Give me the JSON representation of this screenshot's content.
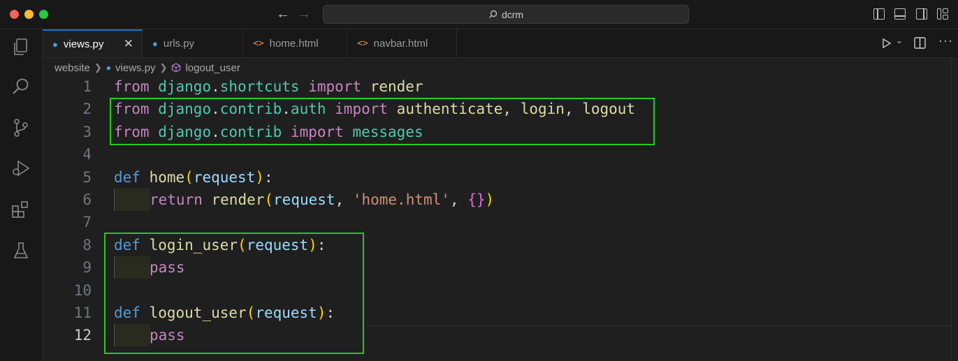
{
  "window": {
    "command_center": "dcrm"
  },
  "tabs": [
    {
      "label": "views.py",
      "type": "python",
      "active": true
    },
    {
      "label": "urls.py",
      "type": "python",
      "active": false
    },
    {
      "label": "home.html",
      "type": "html",
      "active": false
    },
    {
      "label": "navbar.html",
      "type": "html",
      "active": false
    }
  ],
  "breadcrumb": {
    "folder": "website",
    "file": "views.py",
    "symbol": "logout_user"
  },
  "editor": {
    "language": "python",
    "current_line": 12,
    "lines": [
      {
        "n": "1",
        "tokens": [
          [
            "kw-import",
            "from"
          ],
          [
            "plain",
            " "
          ],
          [
            "mod",
            "django"
          ],
          [
            "plain",
            "."
          ],
          [
            "mod",
            "shortcuts"
          ],
          [
            "plain",
            " "
          ],
          [
            "kw-import",
            "import"
          ],
          [
            "plain",
            " "
          ],
          [
            "fn",
            "render"
          ]
        ]
      },
      {
        "n": "2",
        "tokens": [
          [
            "kw-import",
            "from"
          ],
          [
            "plain",
            " "
          ],
          [
            "mod",
            "django"
          ],
          [
            "plain",
            "."
          ],
          [
            "mod",
            "contrib"
          ],
          [
            "plain",
            "."
          ],
          [
            "mod",
            "auth"
          ],
          [
            "plain",
            " "
          ],
          [
            "kw-import",
            "import"
          ],
          [
            "plain",
            " "
          ],
          [
            "fn",
            "authenticate"
          ],
          [
            "plain",
            ", "
          ],
          [
            "fn",
            "login"
          ],
          [
            "plain",
            ", "
          ],
          [
            "fn",
            "logout"
          ]
        ]
      },
      {
        "n": "3",
        "tokens": [
          [
            "kw-import",
            "from"
          ],
          [
            "plain",
            " "
          ],
          [
            "mod",
            "django"
          ],
          [
            "plain",
            "."
          ],
          [
            "mod",
            "contrib"
          ],
          [
            "plain",
            " "
          ],
          [
            "kw-import",
            "import"
          ],
          [
            "plain",
            " "
          ],
          [
            "mod",
            "messages"
          ]
        ]
      },
      {
        "n": "4",
        "tokens": []
      },
      {
        "n": "5",
        "tokens": [
          [
            "kw-def",
            "def"
          ],
          [
            "plain",
            " "
          ],
          [
            "fn",
            "home"
          ],
          [
            "paren",
            "("
          ],
          [
            "param",
            "request"
          ],
          [
            "paren",
            ")"
          ],
          [
            "plain",
            ":"
          ]
        ]
      },
      {
        "n": "6",
        "indent": true,
        "tokens": [
          [
            "kw-import",
            "return"
          ],
          [
            "plain",
            " "
          ],
          [
            "fn",
            "render"
          ],
          [
            "paren",
            "("
          ],
          [
            "param",
            "request"
          ],
          [
            "plain",
            ", "
          ],
          [
            "str",
            "'home.html'"
          ],
          [
            "plain",
            ", "
          ],
          [
            "brace",
            "{}"
          ],
          [
            "paren",
            ")"
          ]
        ]
      },
      {
        "n": "7",
        "tokens": []
      },
      {
        "n": "8",
        "tokens": [
          [
            "kw-def",
            "def"
          ],
          [
            "plain",
            " "
          ],
          [
            "fn",
            "login_user"
          ],
          [
            "paren",
            "("
          ],
          [
            "param",
            "request"
          ],
          [
            "paren",
            ")"
          ],
          [
            "plain",
            ":"
          ]
        ]
      },
      {
        "n": "9",
        "indent": true,
        "tokens": [
          [
            "kw-import",
            "pass"
          ]
        ]
      },
      {
        "n": "10",
        "tokens": []
      },
      {
        "n": "11",
        "tokens": [
          [
            "kw-def",
            "def"
          ],
          [
            "plain",
            " "
          ],
          [
            "fn",
            "logout_user"
          ],
          [
            "paren",
            "("
          ],
          [
            "param",
            "request"
          ],
          [
            "paren",
            ")"
          ],
          [
            "plain",
            ":"
          ]
        ]
      },
      {
        "n": "12",
        "indent": true,
        "tokens": [
          [
            "kw-import",
            "pass"
          ]
        ]
      }
    ]
  },
  "colors": {
    "highlight_box": "#22cc22",
    "tab_accent": "#0078d4"
  }
}
